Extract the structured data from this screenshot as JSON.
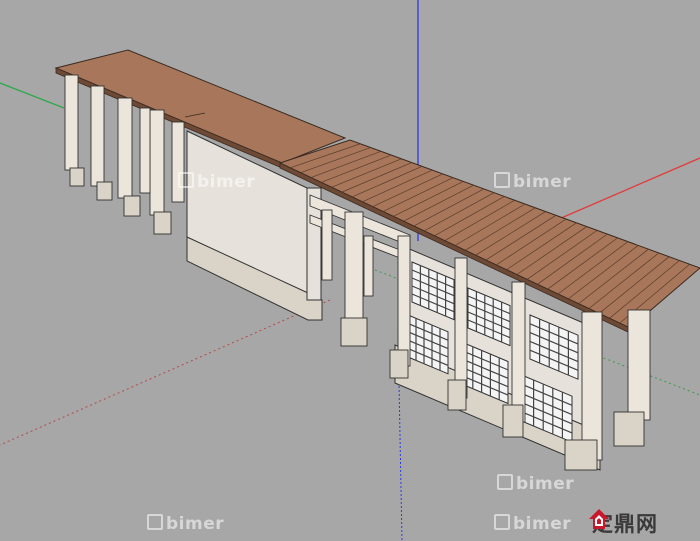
{
  "watermarks": [
    "bimer",
    "bimer",
    "bimer",
    "bimer",
    "bimer"
  ],
  "logo": {
    "text": "定鼎网",
    "color": "#c8192c"
  },
  "colors": {
    "background": "#a7a7a7",
    "roof": "#a8765a",
    "wall": "#e6e1da",
    "base": "#d9d3c8",
    "axis_red": "#e23a3a",
    "axis_green": "#2fa84a",
    "axis_blue": "#2d3ae0"
  }
}
